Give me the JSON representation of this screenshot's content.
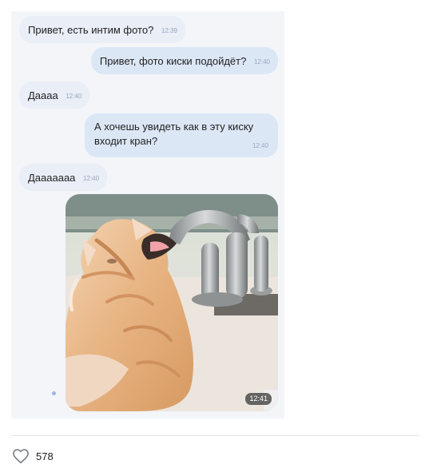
{
  "chat": {
    "messages": [
      {
        "text": "Привет, есть интим фото?",
        "time": "12:39",
        "direction": "in"
      },
      {
        "text": "Привет, фото киски подойдёт?",
        "time": "12:40",
        "direction": "out"
      },
      {
        "text": "Даааа",
        "time": "12:40",
        "direction": "in"
      },
      {
        "text": "А хочешь увидеть как в эту киску входит кран?",
        "time": "12:40",
        "direction": "out"
      },
      {
        "text": "Дааааааа",
        "time": "12:40",
        "direction": "in"
      }
    ],
    "photo_time": "12:41"
  },
  "post": {
    "like_count": "578"
  },
  "icons": {
    "like": "heart-icon"
  },
  "colors": {
    "incoming_bubble": "#e9eef7",
    "outgoing_bubble": "#dce7f6",
    "chat_background": "#f3f5f9",
    "text": "#222222",
    "meta_text": "#9aa7bd"
  }
}
